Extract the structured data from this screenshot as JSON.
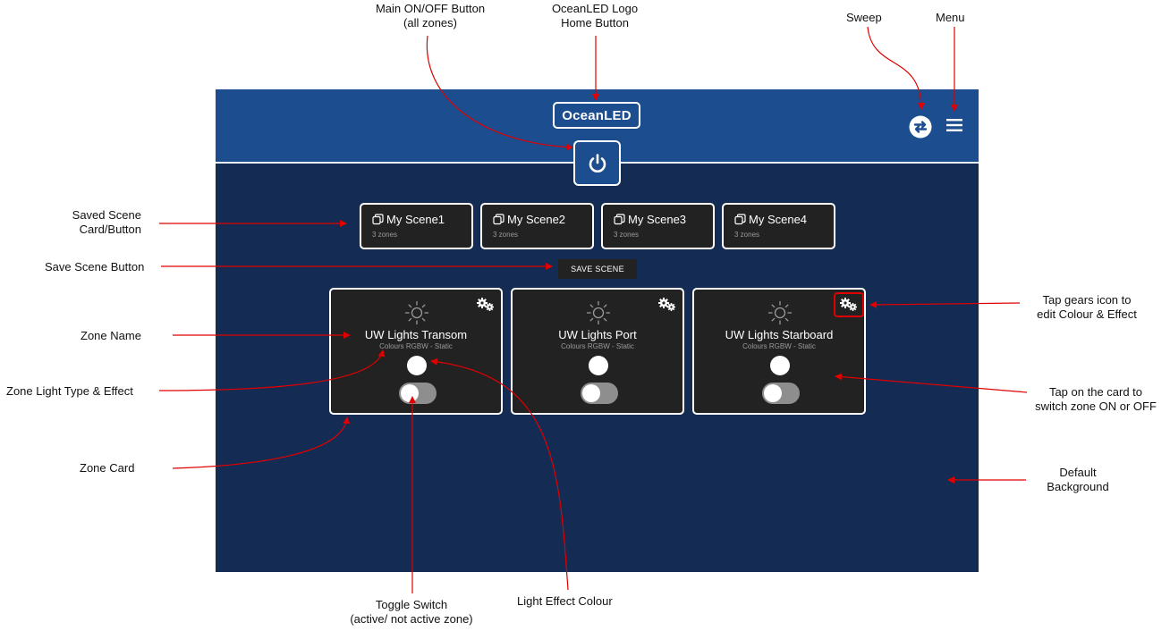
{
  "annotations": {
    "main_power": [
      "Main ON/OFF Button",
      "(all zones)"
    ],
    "logo": [
      "OceanLED Logo",
      "Home Button"
    ],
    "sweep": "Sweep",
    "menu": "Menu",
    "saved_scene": [
      "Saved Scene",
      "Card/Button"
    ],
    "save_scene": "Save Scene Button",
    "zone_name": "Zone Name",
    "light_type": "Zone  Light Type & Effect",
    "zone_card": "Zone Card",
    "tap_gears": [
      "Tap gears icon to",
      "edit Colour & Effect"
    ],
    "tap_card": [
      "Tap on the card to",
      "switch zone ON or OFF"
    ],
    "default_bg": [
      "Default",
      "Background"
    ],
    "toggle_switch": [
      "Toggle Switch",
      "(active/ not active zone)"
    ],
    "light_effect": "Light Effect Colour"
  },
  "app": {
    "logo_text": "OceanLED",
    "save_scene_label": "SAVE SCENE",
    "scenes": [
      {
        "title": "My Scene1",
        "subtitle": "3 zones"
      },
      {
        "title": "My Scene2",
        "subtitle": "3 zones"
      },
      {
        "title": "My Scene3",
        "subtitle": "3 zones"
      },
      {
        "title": "My Scene4",
        "subtitle": "3 zones"
      }
    ],
    "zones": [
      {
        "name": "UW Lights Transom",
        "subtitle": "Colours RGBW - Static",
        "active": false
      },
      {
        "name": "UW Lights Port",
        "subtitle": "Colours RGBW - Static",
        "active": false
      },
      {
        "name": "UW Lights Starboard",
        "subtitle": "Colours RGBW - Static",
        "active": false
      }
    ],
    "icons": {
      "power": "power-icon",
      "sweep": "sweep-icon",
      "menu": "hamburger-menu-icon",
      "scene": "scene-copy-icon",
      "sun": "sun-icon",
      "gears": "gears-icon"
    },
    "colors": {
      "header": "#1c4d8e",
      "background": "#142b53",
      "card": "#222222",
      "annotation_arrow": "#e00000"
    }
  }
}
